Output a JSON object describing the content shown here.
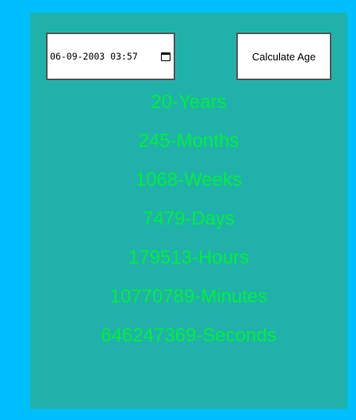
{
  "age_form": {
    "datetime_value": "06-09-2003 03:57",
    "calculate_label": "Calculate Age"
  },
  "results": [
    "20-Years",
    "245-Months",
    "1068-Weeks",
    "7479-Days",
    "179513-Hours",
    "10770789-Minutes",
    "646247369-Seconds"
  ],
  "colors": {
    "page_background": "#00bfff",
    "card_background": "#20b2aa",
    "result_text": "#00ee3e"
  },
  "icons": {
    "datetime_picker": "calendar-icon"
  }
}
